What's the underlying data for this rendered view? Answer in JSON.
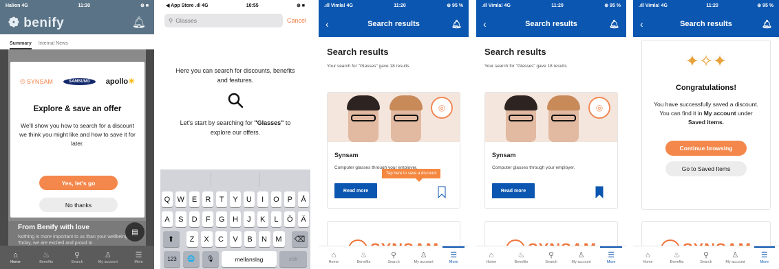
{
  "phone1": {
    "status": {
      "carrier": "Halion 4G",
      "time": "11:30",
      "battery": "⊕ ■"
    },
    "app_logo": "benify",
    "subtabs": [
      "Summary",
      "Internal News"
    ],
    "modal": {
      "brand_synsam": "SYNSAM",
      "brand_samsung": "SAMSUNG",
      "brand_apollo": "apollo",
      "title": "Explore & save an offer",
      "text": "We'll show you how to search for a discount we think you might like and how to save it for later.",
      "primary": "Yes, let's go",
      "secondary": "No thanks"
    },
    "feed": {
      "title": "From Benify with love",
      "text": "Nothing is more important to us than your wellbeing. Today, we are excited and proud to"
    },
    "tabs": [
      "Home",
      "Benefits",
      "Search",
      "My account",
      "More"
    ]
  },
  "phone2": {
    "status": {
      "carrier": "◀ App Store .ıll 4G",
      "time": "10:55",
      "battery": "⊕ ■"
    },
    "search": {
      "value": "Glasses",
      "cancel": "Cancel"
    },
    "intro": "Here you can search for discounts, benefits and features.",
    "intro2_before": "Let's start by searching for ",
    "intro2_strong": "\"Glasses\"",
    "intro2_after": " to explore our offers.",
    "keyboard": {
      "row1": [
        "Q",
        "W",
        "E",
        "R",
        "T",
        "Y",
        "U",
        "I",
        "O",
        "P",
        "Å"
      ],
      "row2": [
        "A",
        "S",
        "D",
        "F",
        "G",
        "H",
        "J",
        "K",
        "L",
        "Ö",
        "Ä"
      ],
      "row3": [
        "Z",
        "X",
        "C",
        "V",
        "B",
        "N",
        "M"
      ],
      "shift": "⬆",
      "backspace": "⌫",
      "numbers": "123",
      "globe": "🌐",
      "mic": "🎙",
      "space": "mellanslag",
      "go": "sök"
    }
  },
  "result_screens": {
    "status": {
      "carrier": ".ıll Vimla! 4G",
      "time": "11:20",
      "battery": "⊕ 95 %"
    },
    "header_title": "Search results",
    "results_title": "Search results",
    "results_sub": "Your search for \"Glasses\" gave 18 results",
    "card": {
      "name": "Synsam",
      "desc": "Computer glasses through your employer.",
      "read_more": "Read more"
    },
    "tooltip": "Tap here to save a discount",
    "logo_text": "SYNSAM",
    "tabs": [
      "Home",
      "Benefits",
      "Search",
      "My account",
      "More"
    ]
  },
  "phone5": {
    "title": "Congratulations!",
    "text_before": "You have successfully saved a discount. You can find it in ",
    "text_strong1": "My account",
    "text_mid": " under ",
    "text_strong2": "Saved items.",
    "continue": "Continue browsing",
    "saved": "Go to Saved Items"
  },
  "colors": {
    "brand_blue": "#0b56b0",
    "accent_orange": "#f4874b"
  },
  "icons": {
    "back": "chevron-left-icon",
    "bell": "bell-icon",
    "search": "search-icon",
    "bookmark": "bookmark-icon",
    "home": "home-icon",
    "benefits": "benefits-icon",
    "account": "user-icon",
    "more": "menu-icon"
  }
}
